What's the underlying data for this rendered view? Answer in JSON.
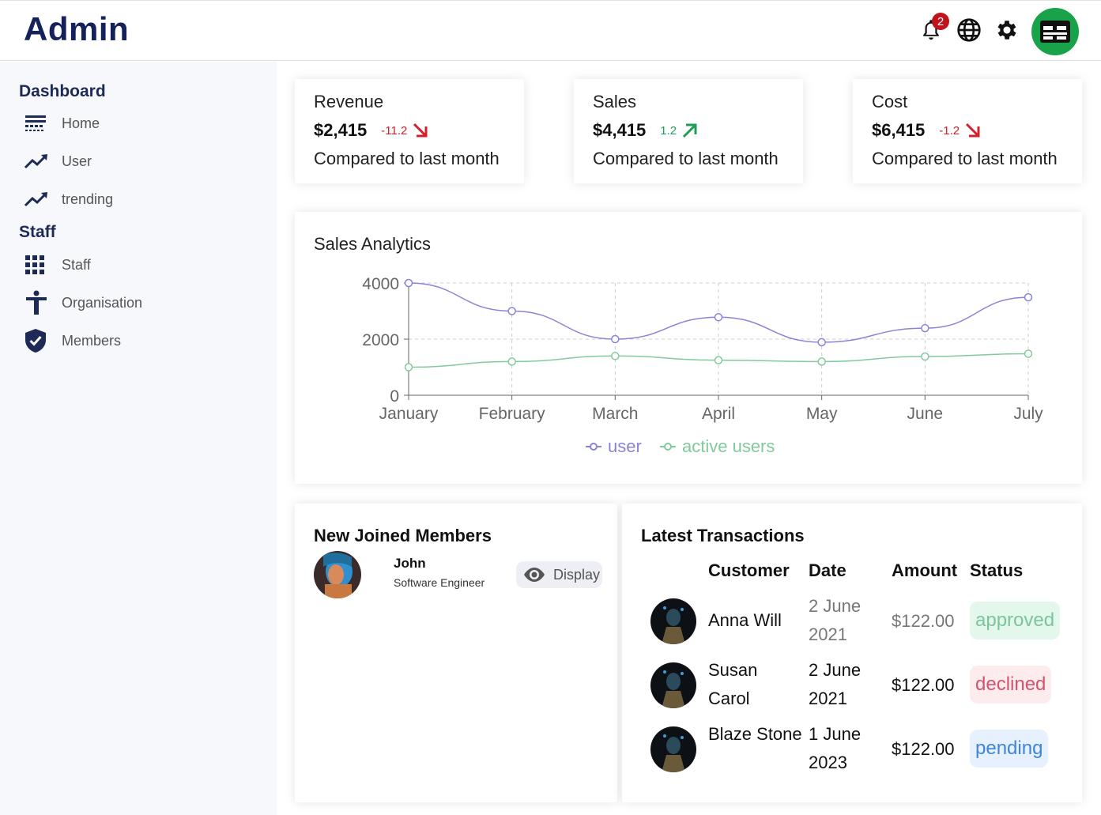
{
  "header": {
    "logo": "Admin",
    "notification_count": "2",
    "icons": [
      "bell-icon",
      "globe-icon",
      "gear-icon",
      "avatar"
    ],
    "avatar_color": "#18a34a"
  },
  "sidebar": {
    "sections": [
      {
        "title": "Dashboard",
        "items": [
          {
            "label": "Home",
            "icon": "home-icon"
          },
          {
            "label": "User",
            "icon": "trending-up-icon"
          },
          {
            "label": "trending",
            "icon": "trending-up-icon"
          }
        ]
      },
      {
        "title": "Staff",
        "items": [
          {
            "label": "Staff",
            "icon": "grid-icon"
          },
          {
            "label": "Organisation",
            "icon": "person-icon"
          },
          {
            "label": "Members",
            "icon": "shield-icon"
          }
        ]
      }
    ]
  },
  "featured": [
    {
      "title": "Revenue",
      "value": "$2,415",
      "rate": "-11.2",
      "direction": "down",
      "subtitle": "Compared to last month"
    },
    {
      "title": "Sales",
      "value": "$4,415",
      "rate": "1.2",
      "direction": "up",
      "subtitle": "Compared to last month"
    },
    {
      "title": "Cost",
      "value": "$6,415",
      "rate": "-1.2",
      "direction": "down",
      "subtitle": "Compared to last month"
    }
  ],
  "colors": {
    "brand": "#15215a",
    "negative": "#d3202a",
    "positive": "#1f9d55",
    "user_series": "#8884d8",
    "active_series": "#82ca9d"
  },
  "analytics": {
    "title": "Sales Analytics"
  },
  "chart_data": {
    "type": "line",
    "title": "Sales Analytics",
    "categories": [
      "January",
      "February",
      "March",
      "April",
      "May",
      "June",
      "July"
    ],
    "series": [
      {
        "name": "user",
        "values": [
          4000,
          3000,
          2000,
          2780,
          1890,
          2390,
          3490
        ]
      },
      {
        "name": "active users",
        "values": [
          1000,
          1200,
          1400,
          1250,
          1200,
          1380,
          1480
        ]
      }
    ],
    "ylim": [
      0,
      4000
    ],
    "yticks": [
      "0",
      "2000",
      "4000"
    ],
    "grid": true,
    "legend": "bottom-center"
  },
  "members": {
    "title": "New Joined Members",
    "items": [
      {
        "name": "John",
        "role": "Software Engineer",
        "button": "Display"
      }
    ]
  },
  "transactions": {
    "title": "Latest Transactions",
    "headers": [
      "Customer",
      "Date",
      "Amount",
      "Status"
    ],
    "rows": [
      {
        "customer": "Anna Will",
        "date": "2 June 2021",
        "amount": "$122.00",
        "status": "approved"
      },
      {
        "customer": "Susan Carol",
        "date": "2 June 2021",
        "amount": "$122.00",
        "status": "declined"
      },
      {
        "customer": "Blaze Stone",
        "date": "1 June 2023",
        "amount": "$122.00",
        "status": "pending"
      }
    ]
  }
}
